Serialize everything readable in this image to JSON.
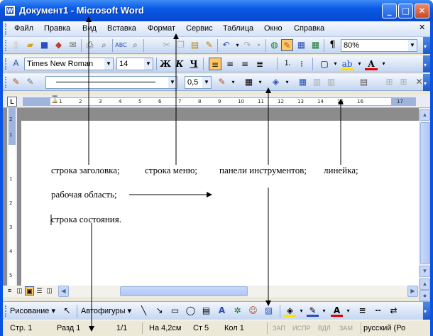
{
  "window": {
    "title": "Документ1 - Microsoft Word",
    "app_icon_letter": "W"
  },
  "menubar": {
    "items": [
      "Файл",
      "Правка",
      "Вид",
      "Вставка",
      "Формат",
      "Сервис",
      "Таблица",
      "Окно",
      "Справка"
    ]
  },
  "standard_toolbar": {
    "icons": [
      "new-document-icon",
      "open-icon",
      "save-icon",
      "permission-icon",
      "email-icon",
      "print-icon",
      "print-preview-icon",
      "spelling-icon",
      "research-icon",
      "cut-icon",
      "copy-icon",
      "paste-icon",
      "format-painter-icon",
      "undo-icon",
      "redo-icon",
      "hyperlink-icon",
      "tables-borders-icon",
      "insert-table-icon",
      "insert-excel-icon",
      "show-hide-icon"
    ],
    "zoom": "80%"
  },
  "formatting_toolbar": {
    "style_icon": "styles-icon",
    "font_name": "Times New Roman",
    "font_size": "14",
    "bold": "Ж",
    "italic": "К",
    "underline": "Ч",
    "active_alignment": "align-left"
  },
  "tables_toolbar": {
    "line_weight": "0,5"
  },
  "ruler": {
    "tab_selector": "L",
    "numbers": [
      "1",
      "2",
      "3",
      "4",
      "5",
      "6",
      "7",
      "8",
      "9",
      "10",
      "11",
      "12",
      "13",
      "14",
      "15",
      "16",
      "17"
    ],
    "vertical_numbers": [
      "2",
      "1",
      "1",
      "2",
      "3",
      "4",
      "5"
    ]
  },
  "document": {
    "lines": [
      "строка заголовка;",
      "строка меню;",
      "панели инструментов;",
      "линейка;",
      "рабочая область;",
      "строка состояния."
    ]
  },
  "drawing_toolbar": {
    "drawing_label": "Рисование ▾",
    "autoshapes_label": "Автофигуры ▾"
  },
  "statusbar": {
    "page": "Стр. 1",
    "section": "Разд 1",
    "pages": "1/1",
    "at": "На 4,2см",
    "line": "Ст 5",
    "col": "Кол 1",
    "rec": "ЗАП",
    "trk": "ИСПР",
    "ext": "ВДЛ",
    "ovr": "ЗАМ",
    "language": "русский (Ро"
  },
  "colors": {
    "titlebar": "#0a54e3",
    "toolbar": "#c4d6f2",
    "workspace": "#8c8c8c"
  }
}
